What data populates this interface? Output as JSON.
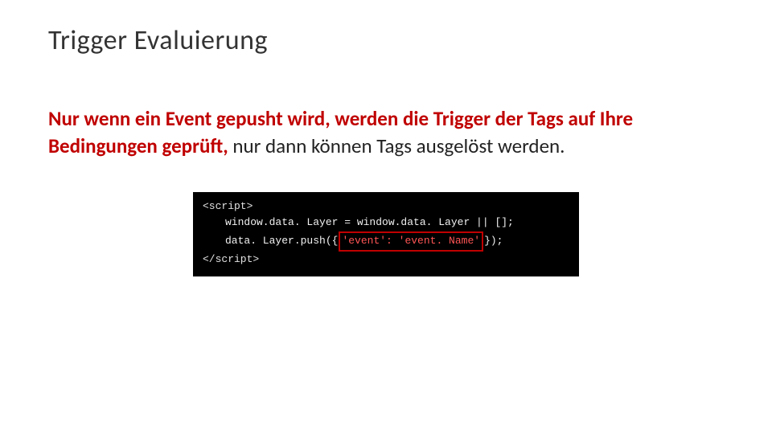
{
  "slide": {
    "title": "Trigger Evaluierung",
    "paragraph": {
      "part1_highlight": "Nur wenn ein Event gepusht wird, werden die Trigger der Tags auf Ihre Bedingungen geprüft,",
      "part2_plain": " nur dann können Tags ausgelöst werden."
    },
    "code": {
      "line1": "<script>",
      "line2_a": "window.data. Layer = window.data. Layer || [];",
      "line3_a": "data. Layer.push({",
      "line3_box": "'event': 'event. Name'",
      "line3_b": "});",
      "line4": "</script>"
    }
  }
}
